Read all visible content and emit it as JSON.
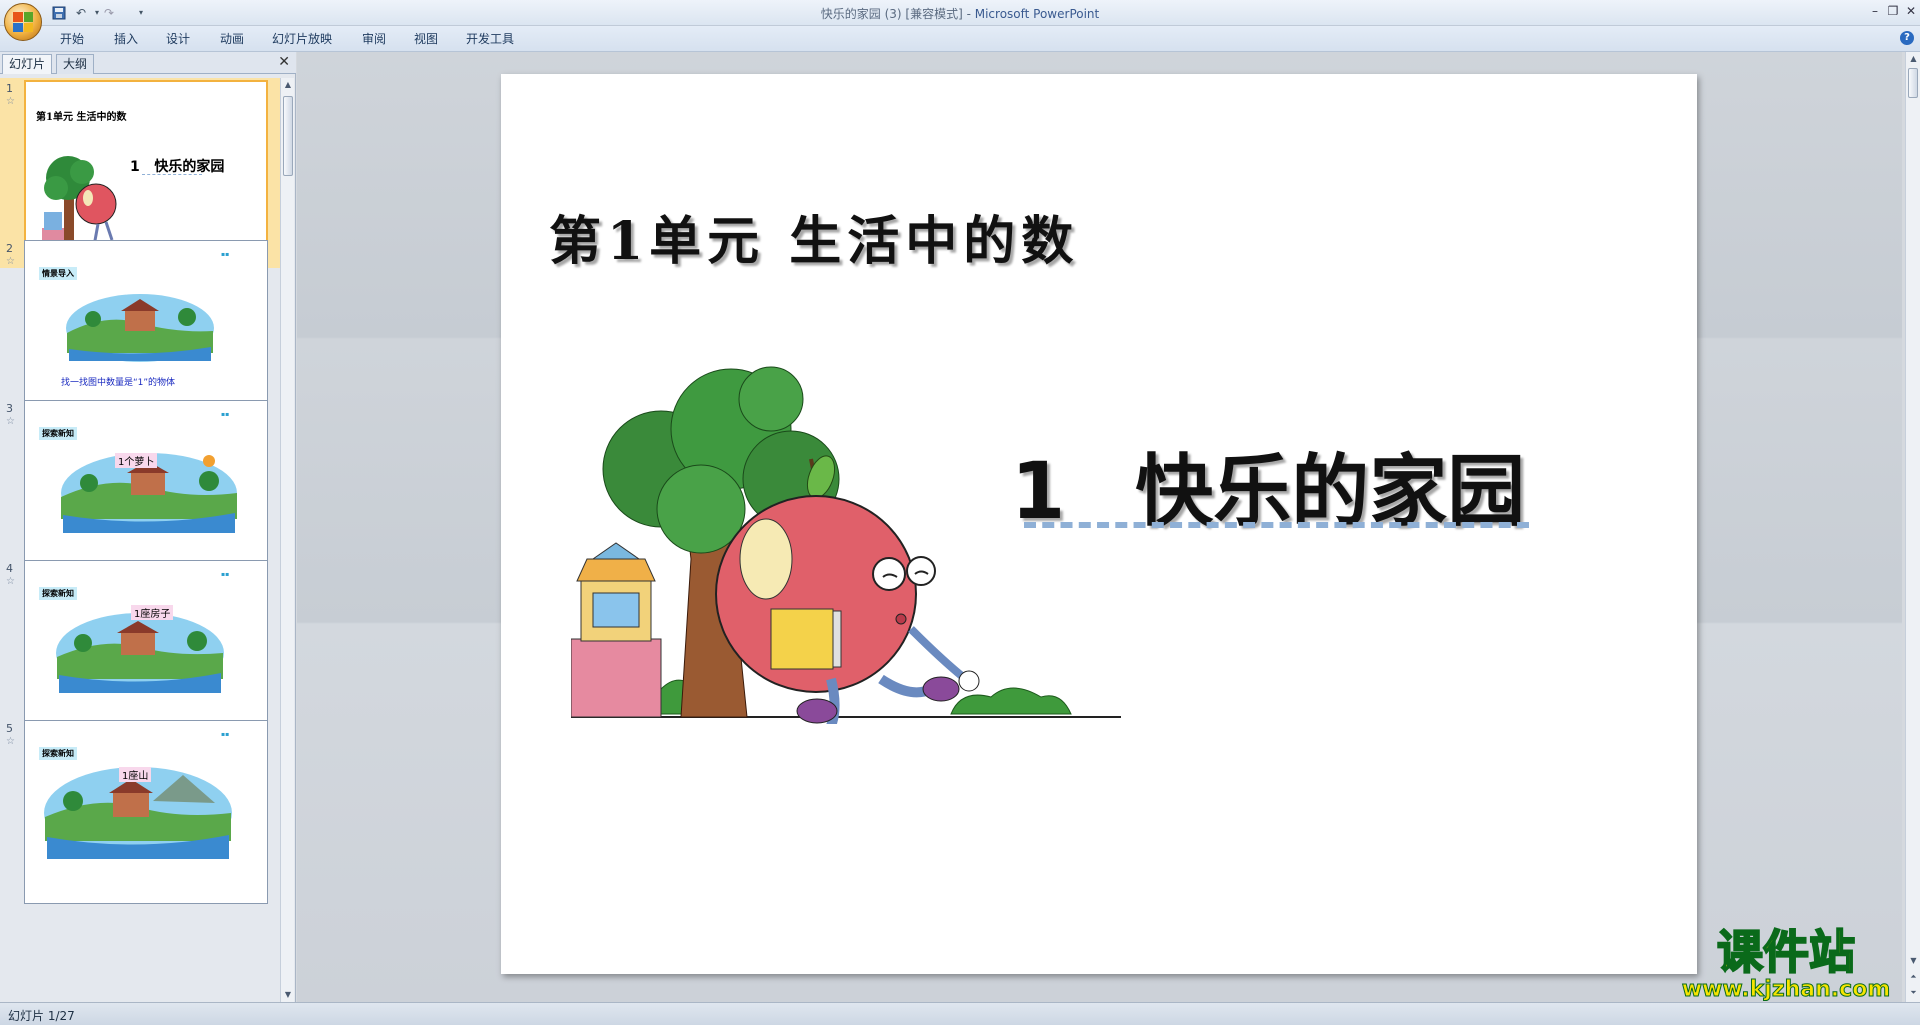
{
  "window": {
    "title_doc": "快乐的家园 (3) [兼容模式]",
    "title_sep": " - ",
    "title_app": "Microsoft PowerPoint"
  },
  "quick_access": {
    "save_icon": "save-icon",
    "undo_icon": "undo-icon",
    "redo_icon": "redo-icon",
    "customize_icon": "dropdown-icon"
  },
  "ribbon": {
    "tabs": [
      "开始",
      "插入",
      "设计",
      "动画",
      "幻灯片放映",
      "审阅",
      "视图",
      "开发工具"
    ]
  },
  "left_pane": {
    "tabs": [
      "幻灯片",
      "大纲"
    ],
    "close_label": "✕"
  },
  "thumbnails": [
    {
      "num": "1",
      "heading": "第1单元  生活中的数",
      "title": "1   快乐的家园"
    },
    {
      "num": "2",
      "tag": "情景导入",
      "caption": "找一找图中数量是“1”的物体"
    },
    {
      "num": "3",
      "tag": "探索新知",
      "label": "1个萝卜"
    },
    {
      "num": "4",
      "tag": "探索新知",
      "label": "1座房子"
    },
    {
      "num": "5",
      "tag": "探索新知",
      "label": "1座山"
    }
  ],
  "slide": {
    "unit_title": "第1单元  生活中的数",
    "lesson_number": "1",
    "lesson_name": "快乐的家园"
  },
  "status": {
    "slide_counter": "幻灯片 1/27"
  },
  "watermark": {
    "text": "课件站",
    "url": "www.kjzhan.com"
  },
  "colors": {
    "accent_ribbon": "#dbe5f1",
    "selected_thumb": "#fbe3a6",
    "underline": "#8fb0d6",
    "watermark_yellow": "#f6e400",
    "watermark_green": "#0a8a2a"
  }
}
